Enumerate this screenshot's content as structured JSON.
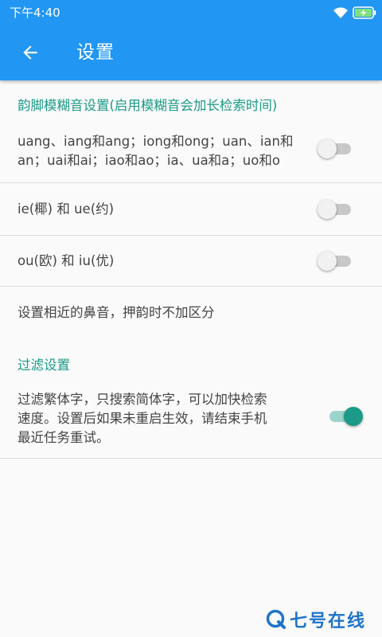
{
  "status_bar": {
    "time": "下午4:40",
    "icons": [
      "wifi-icon",
      "battery-charging-icon"
    ]
  },
  "app_bar": {
    "back_icon": "arrow-left-icon",
    "title": "设置"
  },
  "rhyme_section": {
    "header": "韵脚模糊音设置(启用模糊音会加长检索时间)",
    "items": [
      {
        "line1": "uang、iang和ang；iong和ong；uan、ian和",
        "line2": "an；uai和ai；iao和ao；ia、ua和a；uo和o",
        "enabled": false
      },
      {
        "line1": "ie(椰) 和 ue(约)",
        "enabled": false
      },
      {
        "line1": "ou(欧) 和 iu(优)",
        "enabled": false
      }
    ],
    "nasal_text": "设置相近的鼻音，押韵时不加区分"
  },
  "filter_section": {
    "header": "过滤设置",
    "item": {
      "line1": "过滤繁体字，只搜索简体字，可以加快检索",
      "line2": "速度。设置后如果未重启生效，请结束手机",
      "line3": "最近任务重试。",
      "enabled": true
    }
  },
  "watermark": {
    "text": "七号在线",
    "icon": "q-logo-icon"
  },
  "colors": {
    "primary": "#2196f3",
    "accent": "#1a9a87",
    "section_header": "#1b9a87",
    "switch_off_track": "#c8c8c8",
    "watermark": "#1f74c9"
  }
}
